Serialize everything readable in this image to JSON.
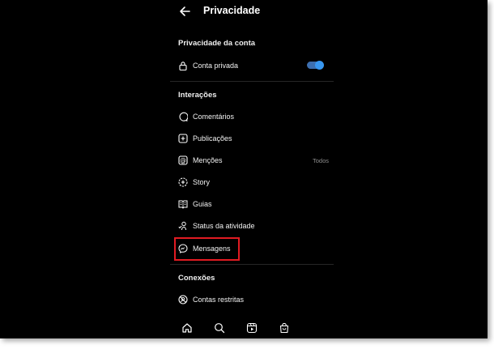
{
  "header": {
    "title": "Privacidade"
  },
  "sections": {
    "account": "Privacidade da conta",
    "interactions": "Interações",
    "connections": "Conexões"
  },
  "account": {
    "private_label": "Conta privada",
    "private_enabled": true
  },
  "interactions": {
    "items": [
      {
        "label": "Comentários",
        "icon": "comment-icon"
      },
      {
        "label": "Publicações",
        "icon": "add-post-icon"
      },
      {
        "label": "Menções",
        "icon": "at-icon",
        "value": "Todos"
      },
      {
        "label": "Story",
        "icon": "story-icon"
      },
      {
        "label": "Guias",
        "icon": "guides-icon"
      },
      {
        "label": "Status da atividade",
        "icon": "activity-status-icon"
      },
      {
        "label": "Mensagens",
        "icon": "messenger-icon"
      }
    ]
  },
  "connections": {
    "items": [
      {
        "label": "Contas restritas",
        "icon": "restricted-icon"
      }
    ]
  },
  "bottom_nav": [
    "home-icon",
    "search-icon",
    "reels-icon",
    "shop-icon"
  ],
  "colors": {
    "toggle": "#3897f0",
    "highlight": "#e11b22"
  }
}
